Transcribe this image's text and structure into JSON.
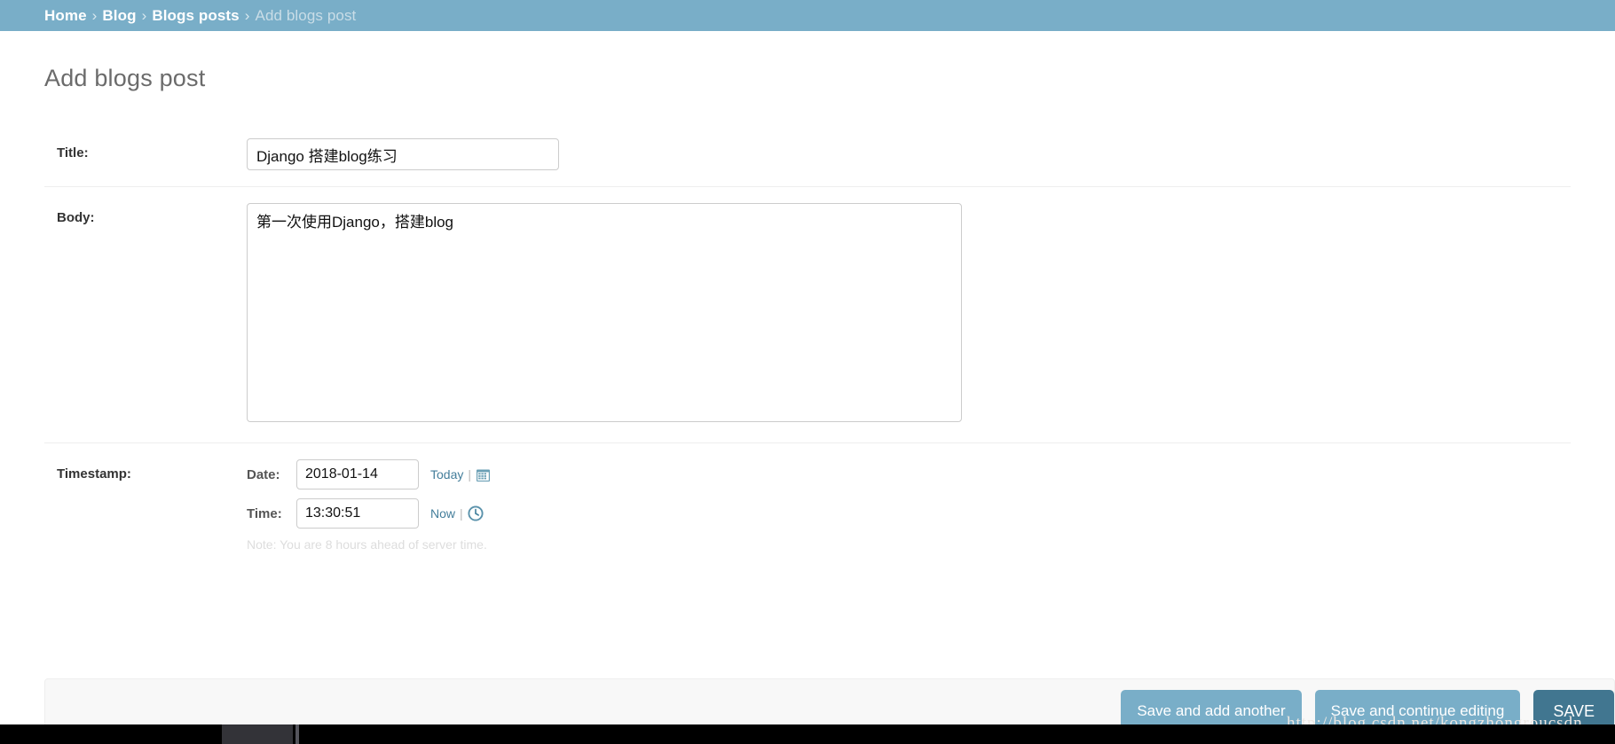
{
  "breadcrumb": {
    "items": [
      {
        "label": "Home",
        "current": false
      },
      {
        "label": "Blog",
        "current": false
      },
      {
        "label": "Blogs posts",
        "current": false
      },
      {
        "label": "Add blogs post",
        "current": true
      }
    ],
    "separator": "›"
  },
  "page": {
    "title": "Add blogs post"
  },
  "form": {
    "title_field": {
      "label": "Title:",
      "value": "Django 搭建blog练习",
      "placeholder": ""
    },
    "body_field": {
      "label": "Body:",
      "value": "第一次使用Django，搭建blog",
      "placeholder": ""
    },
    "timestamp_field": {
      "label": "Timestamp:",
      "date": {
        "label": "Date:",
        "value": "2018-01-14",
        "shortcut": "Today",
        "separator": "|",
        "icon": "calendar-icon"
      },
      "time": {
        "label": "Time:",
        "value": "13:30:51",
        "shortcut": "Now",
        "separator": "|",
        "icon": "clock-icon"
      },
      "note": "Note: You are 8 hours ahead of server time."
    }
  },
  "submit_row": {
    "save_and_add_another": "Save and add another",
    "save_and_continue": "Save and continue editing",
    "save": "SAVE"
  },
  "watermark": "http://blog.csdn.net/kongzhongroucsdn",
  "colors": {
    "header_bg": "#79aec8",
    "button_bg": "#79aec8",
    "button_default_bg": "#417690",
    "link": "#447e9b",
    "submit_row_bg": "#f8f8f8"
  }
}
